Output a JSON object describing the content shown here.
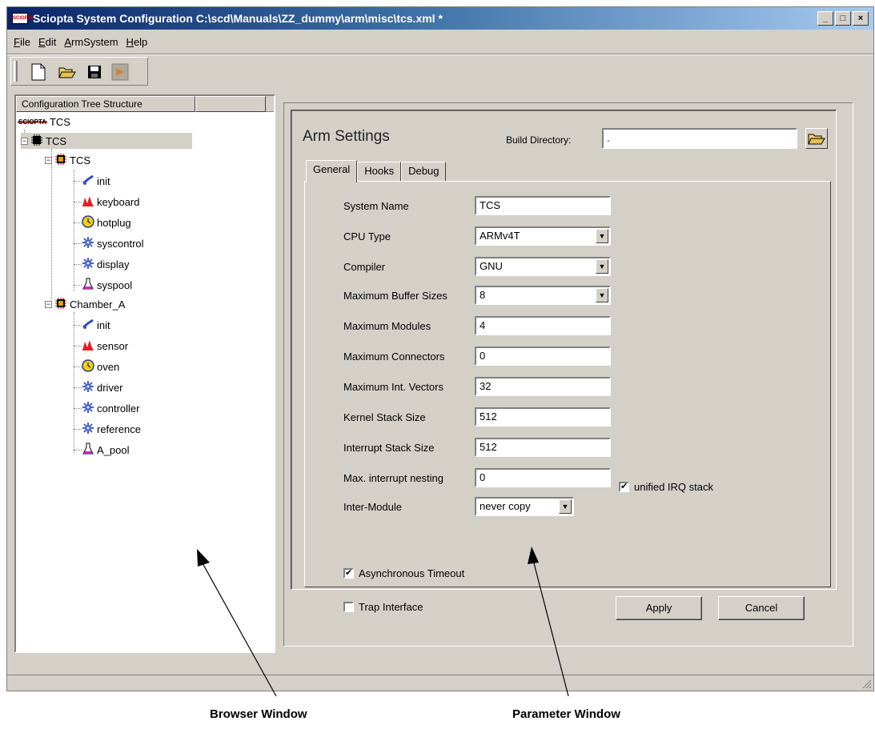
{
  "window": {
    "title": "Sciopta System Configuration    C:\\scd\\Manuals\\ZZ_dummy\\arm\\misc\\tcs.xml *",
    "app_icon_text": "SCIOPTA",
    "buttons": {
      "minimize": "_",
      "maximize": "□",
      "close": "×"
    }
  },
  "menu": [
    "File",
    "Edit",
    "ArmSystem",
    "Help"
  ],
  "toolbar": [
    "new-file-icon",
    "open-folder-icon",
    "save-icon",
    "build-icon"
  ],
  "browser": {
    "header": "Configuration Tree Structure",
    "root": {
      "logo": "SCIOPTA",
      "label": "TCS"
    },
    "tree": [
      {
        "label": "TCS",
        "icon": "system-chip-icon",
        "selected": true
      },
      {
        "label": "TCS",
        "icon": "module-chip-icon"
      },
      {
        "label": "init",
        "icon": "init-process-icon"
      },
      {
        "label": "keyboard",
        "icon": "interrupt-process-icon"
      },
      {
        "label": "hotplug",
        "icon": "timer-process-icon"
      },
      {
        "label": "syscontrol",
        "icon": "prioritized-process-icon"
      },
      {
        "label": "display",
        "icon": "prioritized-process-icon"
      },
      {
        "label": "syspool",
        "icon": "pool-icon"
      },
      {
        "label": "Chamber_A",
        "icon": "module-chip-icon"
      },
      {
        "label": "init",
        "icon": "init-process-icon"
      },
      {
        "label": "sensor",
        "icon": "interrupt-process-icon"
      },
      {
        "label": "oven",
        "icon": "timer-process-icon"
      },
      {
        "label": "driver",
        "icon": "prioritized-process-icon"
      },
      {
        "label": "controller",
        "icon": "prioritized-process-icon"
      },
      {
        "label": "reference",
        "icon": "prioritized-process-icon"
      },
      {
        "label": "A_pool",
        "icon": "pool-icon"
      }
    ]
  },
  "params": {
    "title": "Arm Settings",
    "build_dir_label": "Build Directory:",
    "build_dir_value": ".",
    "tabs": [
      "General",
      "Hooks",
      "Debug"
    ],
    "fields": [
      {
        "label": "System Name",
        "value": "TCS",
        "type": "text"
      },
      {
        "label": "CPU Type",
        "value": "ARMv4T",
        "type": "select"
      },
      {
        "label": "Compiler",
        "value": "GNU",
        "type": "select"
      },
      {
        "label": "Maximum Buffer Sizes",
        "value": "8",
        "type": "select"
      },
      {
        "label": "Maximum Modules",
        "value": "4",
        "type": "text"
      },
      {
        "label": "Maximum Connectors",
        "value": "0",
        "type": "text"
      },
      {
        "label": "Maximum Int. Vectors",
        "value": "32",
        "type": "text"
      },
      {
        "label": "Kernel Stack Size",
        "value": "512",
        "type": "text"
      },
      {
        "label": "Interrupt Stack Size",
        "value": "512",
        "type": "text"
      },
      {
        "label": "Max. interrupt nesting",
        "value": "0",
        "type": "text"
      },
      {
        "label": "Inter-Module",
        "value": "never copy",
        "type": "select"
      }
    ],
    "unified_irq": {
      "label": "unified IRQ stack",
      "checked": true
    },
    "async_timeout": {
      "label": "Asynchronous Timeout",
      "checked": true
    },
    "trap_interface": {
      "label": "Trap Interface",
      "checked": false
    },
    "apply_label": "Apply",
    "cancel_label": "Cancel",
    "check_mark": "✔"
  },
  "captions": {
    "browser": "Browser Window",
    "parameter": "Parameter Window"
  },
  "colors": {
    "title_start": "#0a246a",
    "title_end": "#a6caf0",
    "face": "#d4d0c8"
  }
}
